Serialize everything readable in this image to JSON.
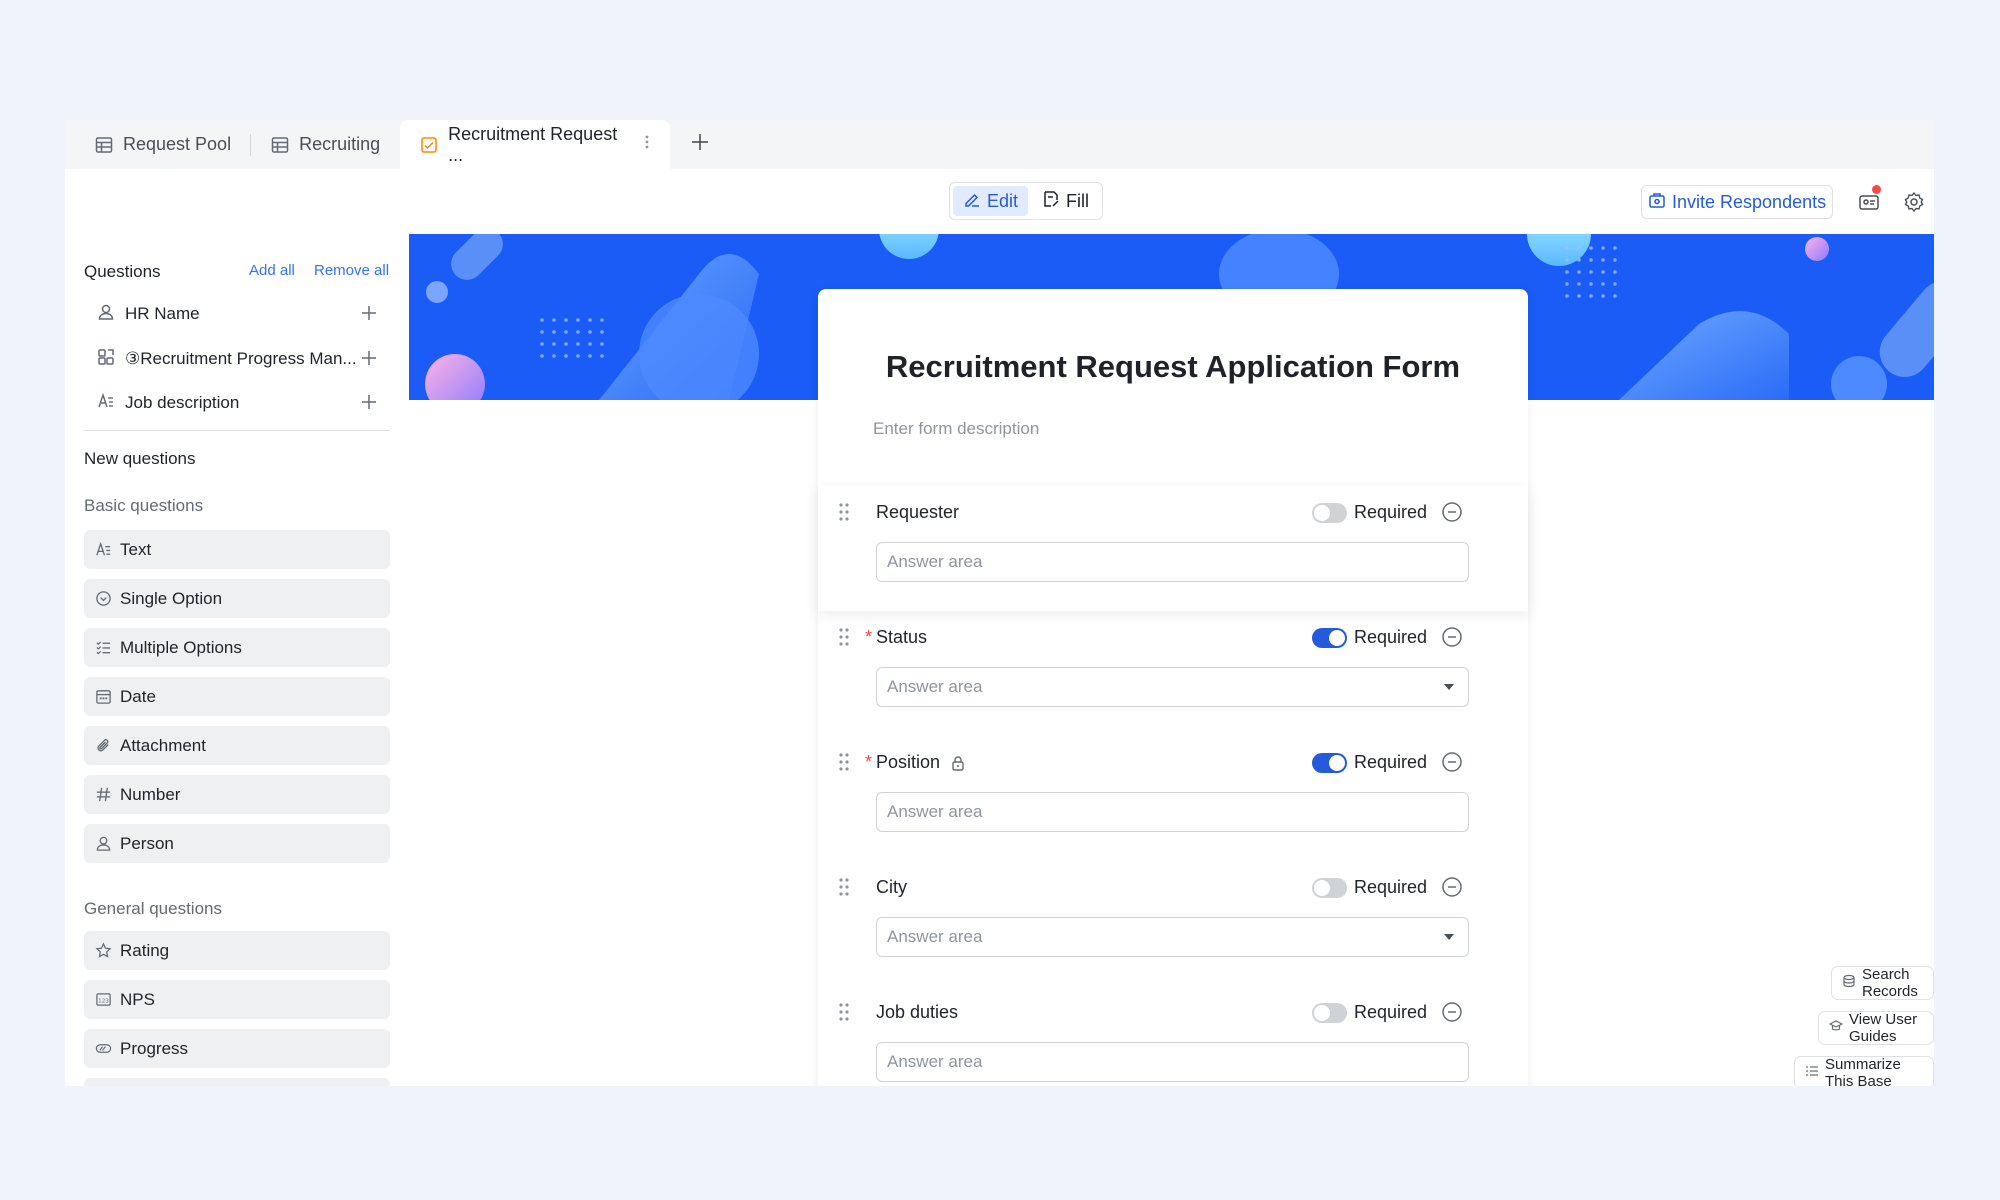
{
  "tabs": [
    {
      "label": "Request Pool",
      "icon": "table-icon"
    },
    {
      "label": "Recruiting",
      "icon": "table-icon"
    },
    {
      "label": "Recruitment Request ...",
      "icon": "form-icon",
      "active": true
    }
  ],
  "toolbar": {
    "edit_label": "Edit",
    "fill_label": "Fill",
    "invite_label": "Invite Respondents"
  },
  "sidebar": {
    "questions_heading": "Questions",
    "add_all": "Add all",
    "remove_all": "Remove all",
    "fields": [
      {
        "label": "HR Name",
        "icon": "person-icon"
      },
      {
        "label": "③Recruitment Progress Man...",
        "icon": "lookup-icon"
      },
      {
        "label": "Job description",
        "icon": "text-icon"
      }
    ],
    "new_questions": "New questions",
    "basic_heading": "Basic questions",
    "basic": [
      {
        "label": "Text",
        "icon": "text-icon"
      },
      {
        "label": "Single Option",
        "icon": "single-option-icon"
      },
      {
        "label": "Multiple Options",
        "icon": "multiple-options-icon"
      },
      {
        "label": "Date",
        "icon": "calendar-icon"
      },
      {
        "label": "Attachment",
        "icon": "paperclip-icon"
      },
      {
        "label": "Number",
        "icon": "hash-icon"
      },
      {
        "label": "Person",
        "icon": "person-icon"
      }
    ],
    "general_heading": "General questions",
    "general": [
      {
        "label": "Rating",
        "icon": "star-icon"
      },
      {
        "label": "NPS",
        "icon": "nps-icon"
      },
      {
        "label": "Progress",
        "icon": "progress-icon"
      }
    ]
  },
  "form": {
    "title": "Recruitment Request Application Form",
    "description_placeholder": "Enter form description",
    "required_label": "Required",
    "questions": [
      {
        "label": "Requester",
        "required": false,
        "answer": "Answer area",
        "dropdown": false
      },
      {
        "label": "Status",
        "required": true,
        "answer": "Answer area",
        "dropdown": true
      },
      {
        "label": "Position",
        "required": true,
        "answer": "Answer area",
        "dropdown": false,
        "locked": true
      },
      {
        "label": "City",
        "required": false,
        "answer": "Answer area",
        "dropdown": true
      },
      {
        "label": "Job duties",
        "required": false,
        "answer": "Answer area",
        "dropdown": false
      }
    ]
  },
  "floating": {
    "search_records": "Search Records",
    "view_user_guides": "View User Guides",
    "summarize_base": "Summarize This Base"
  },
  "colors": {
    "accent": "#245bdb",
    "banner": "#1a5cf5",
    "required_star": "#f54a45"
  }
}
